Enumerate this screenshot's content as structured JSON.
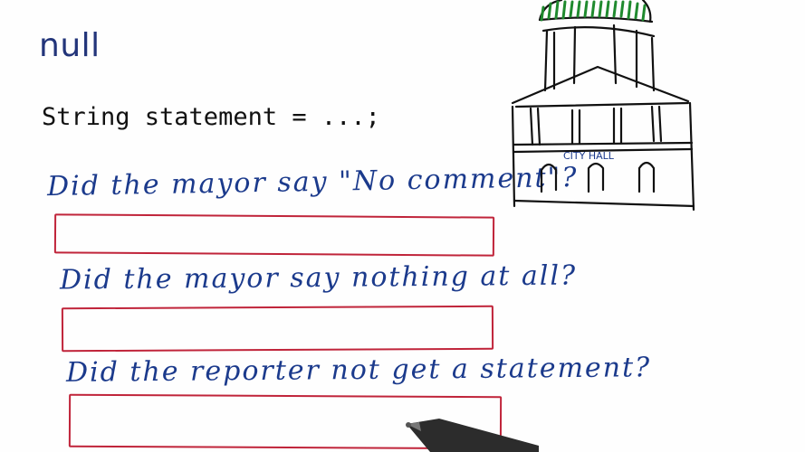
{
  "slide": {
    "title": "null",
    "code": "String statement = ...;"
  },
  "questions": [
    {
      "text": "Did the mayor say \"No comment\"?"
    },
    {
      "text": "Did the mayor say nothing at all?"
    },
    {
      "text": "Did the reporter not get a statement?"
    }
  ],
  "illustration": {
    "sign": "CITY HALL",
    "icon": "city-hall-icon"
  },
  "colors": {
    "title": "#23357a",
    "handwriting": "#1b3a8c",
    "answer_box": "#c0243a",
    "dome": "#1f8a2e"
  }
}
